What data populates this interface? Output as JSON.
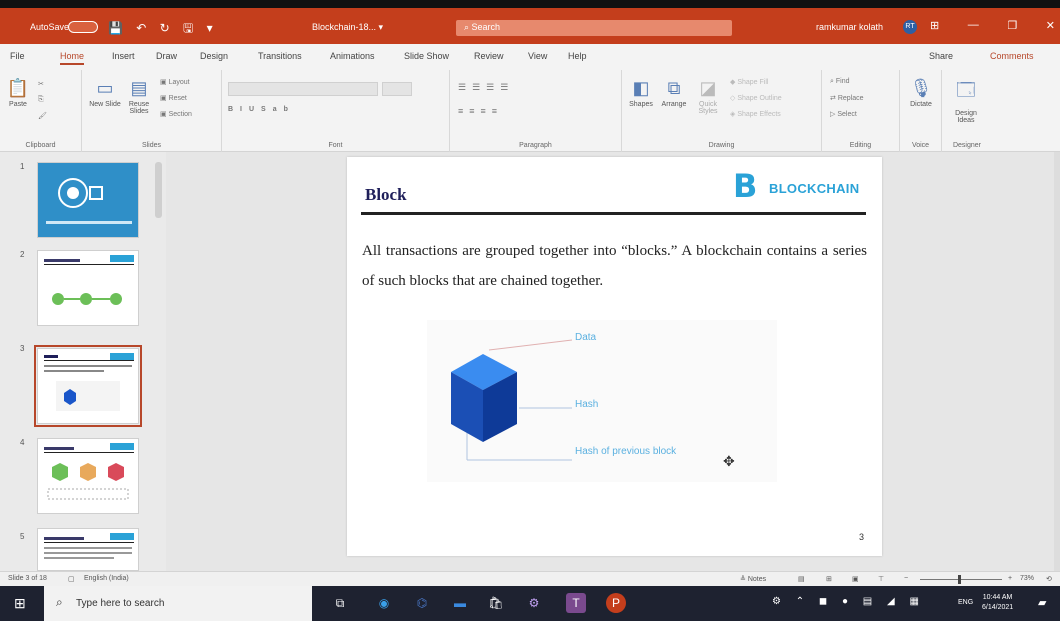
{
  "titlebar": {
    "autosave": "AutoSave",
    "toggle_state": "Off",
    "quick_access": "💾 ↶ ↻ 🖫 ▾",
    "doc_title": "Blockchain-18... ▾",
    "search": "Search",
    "user": "ramkumar kolath",
    "avatar_initials": "RT",
    "controls": [
      "⊞",
      "—",
      "❐",
      "✕"
    ]
  },
  "menu": {
    "tabs": [
      "File",
      "Home",
      "Insert",
      "Draw",
      "Design",
      "Transitions",
      "Animations",
      "Slide Show",
      "Review",
      "View",
      "Help"
    ],
    "active": "Home",
    "share": "Share",
    "comments": "Comments"
  },
  "ribbon": {
    "groups": [
      "Clipboard",
      "Slides",
      "Font",
      "Paragraph",
      "Drawing",
      "Editing",
      "Voice",
      "Designer"
    ],
    "clipboard": {
      "paste": "Paste"
    },
    "slides": {
      "new_slide": "New Slide",
      "reuse": "Reuse Slides",
      "layout": "Layout",
      "reset": "Reset",
      "section": "Section"
    },
    "drawing": {
      "shapes": "Shapes",
      "arrange": "Arrange",
      "quick_styles": "Quick Styles",
      "fill": "Shape Fill",
      "outline": "Shape Outline",
      "effects": "Shape Effects"
    },
    "editing": {
      "find": "Find",
      "replace": "Replace",
      "select": "Select"
    },
    "voice": {
      "dictate": "Dictate"
    },
    "designer": {
      "design_ideas": "Design Ideas"
    }
  },
  "thumbnails": [
    {
      "number": "1",
      "selected": false
    },
    {
      "number": "2",
      "selected": false
    },
    {
      "number": "3",
      "selected": true
    },
    {
      "number": "4",
      "selected": false
    },
    {
      "number": "5",
      "selected": false
    }
  ],
  "slide": {
    "title": "Block",
    "logo_text": "BLOCKCHAIN",
    "body": "All transactions are grouped together into “blocks.” A blockchain contains a series of such blocks that are chained together.",
    "diagram_labels": {
      "data": "Data",
      "hash": "Hash",
      "prev_hash": "Hash of previous block"
    },
    "slide_number": "3"
  },
  "statusbar": {
    "slide_info": "Slide 3 of 18",
    "language": "English (India)",
    "notes": "Notes",
    "zoom": "73%"
  },
  "taskbar": {
    "search_placeholder": "Type here to search",
    "language": "ENG",
    "time": "10:44 AM",
    "date": "6/14/2021"
  },
  "colors": {
    "accent": "#b7472a",
    "titlebar": "#c43e1c",
    "cube": "#1a56c9",
    "logo": "#2aa2d7"
  }
}
